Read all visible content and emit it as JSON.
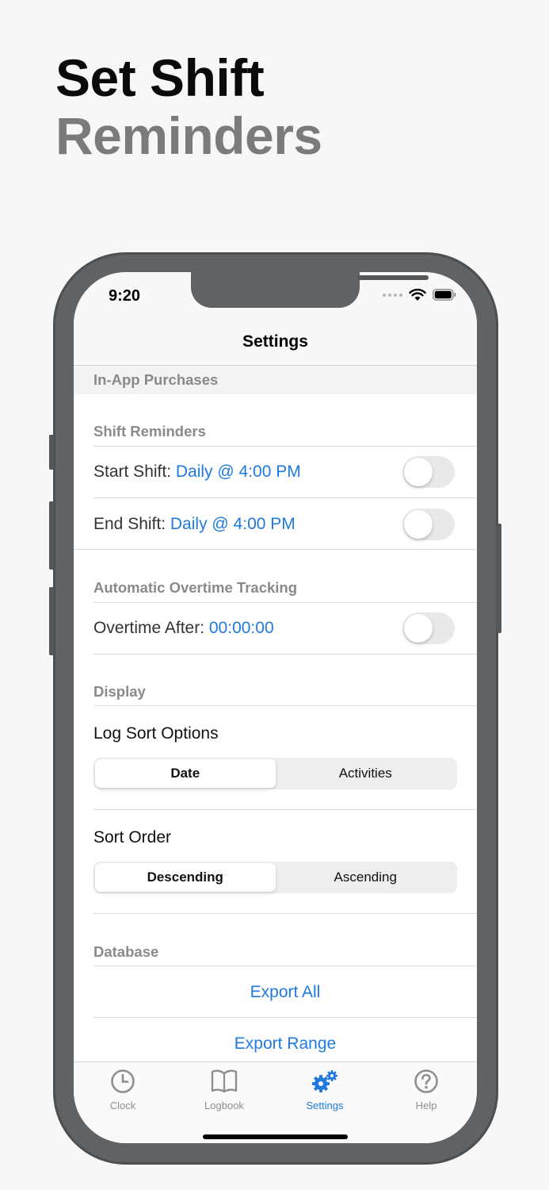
{
  "promo": {
    "line1": "Set Shift",
    "line2": "Reminders"
  },
  "status_bar": {
    "time": "9:20"
  },
  "nav": {
    "title": "Settings"
  },
  "sections": {
    "iap": "In-App Purchases",
    "shift_reminders": "Shift Reminders",
    "overtime": "Automatic Overtime Tracking",
    "display": "Display",
    "database": "Database"
  },
  "reminders": {
    "start": {
      "label": "Start Shift: ",
      "value": "Daily @ 4:00 PM",
      "enabled": false
    },
    "end": {
      "label": "End Shift: ",
      "value": "Daily @ 4:00 PM",
      "enabled": false
    }
  },
  "overtime": {
    "label": "Overtime After: ",
    "value": "00:00:00",
    "enabled": false
  },
  "log_sort": {
    "label": "Log Sort Options",
    "options": [
      "Date",
      "Activities"
    ],
    "selected": "Date"
  },
  "sort_order": {
    "label": "Sort Order",
    "options": [
      "Descending",
      "Ascending"
    ],
    "selected": "Descending"
  },
  "database": {
    "export_all": "Export All",
    "export_range": "Export Range"
  },
  "tabs": [
    {
      "label": "Clock",
      "icon": "clock-icon"
    },
    {
      "label": "Logbook",
      "icon": "book-icon"
    },
    {
      "label": "Settings",
      "icon": "gears-icon",
      "active": true
    },
    {
      "label": "Help",
      "icon": "question-icon"
    }
  ],
  "colors": {
    "accent": "#1f7ae0",
    "frame": "#5f6366",
    "header_gray": "#8a8a8a"
  }
}
